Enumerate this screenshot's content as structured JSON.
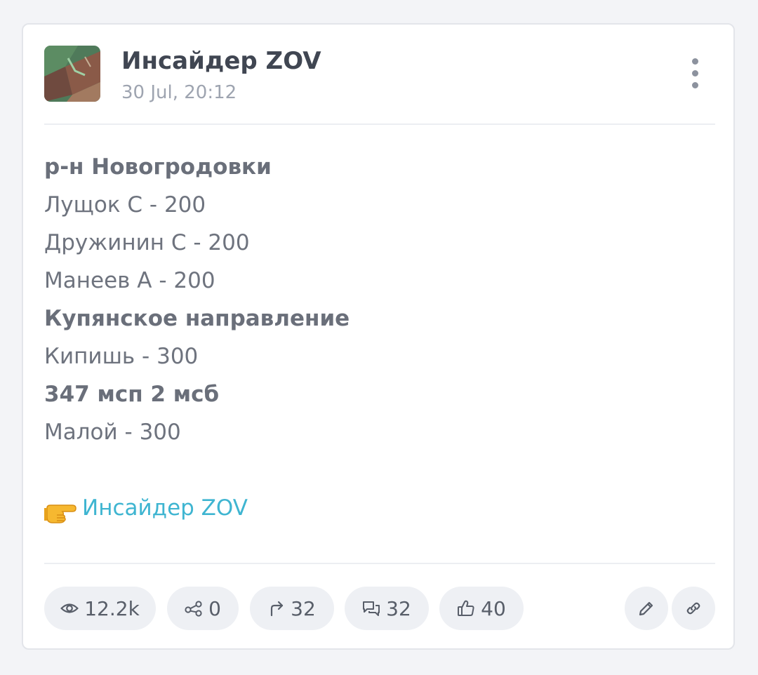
{
  "post": {
    "channel_name": "Инсайдер ZOV",
    "date": "30 Jul, 20:12",
    "lines": [
      {
        "text": "р-н Новогродовки",
        "bold": true
      },
      {
        "text": "Лущок С - 200",
        "bold": false
      },
      {
        "text": "Дружинин С - 200",
        "bold": false
      },
      {
        "text": "Манеев А - 200",
        "bold": false
      },
      {
        "text": "Купянское направление",
        "bold": true
      },
      {
        "text": "Кипишь - 300",
        "bold": false
      },
      {
        "text": "347 мсп 2 мсб",
        "bold": true
      },
      {
        "text": "Малой - 300",
        "bold": false
      }
    ],
    "link": {
      "emoji": "pointing-right-hand-icon",
      "text": "Инсайдер ZOV",
      "color": "#3fb5d1"
    }
  },
  "stats": {
    "views": "12.2k",
    "shares": "0",
    "forwards": "32",
    "comments": "32",
    "reactions": "40"
  },
  "actions": {
    "edit_icon": "pencil-icon",
    "copy_link_icon": "link-icon"
  },
  "colors": {
    "background": "#f3f4f7",
    "card": "#ffffff",
    "title": "#404652",
    "body_text": "#6e737e",
    "muted": "#9ea4b0",
    "pill_bg": "#eef0f4",
    "accent": "#3fb5d1"
  }
}
